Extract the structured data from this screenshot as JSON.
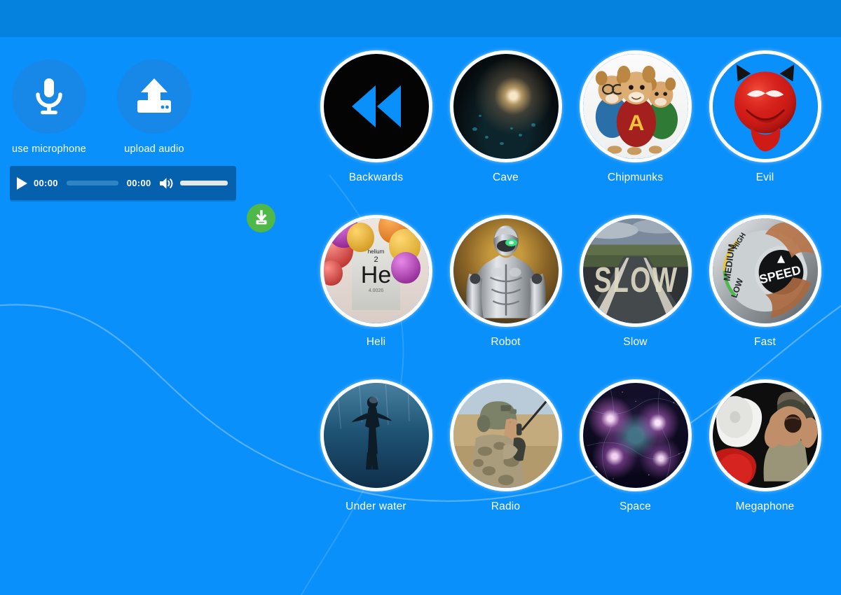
{
  "theme": {
    "background": "#0a90fb",
    "topbar": "#0582de",
    "source_circle": "#1787e8",
    "player_bar": "#0561ad",
    "download_green": "#50b848",
    "label_white": "#ffffff",
    "volume_bar": "#e4e8ea",
    "seek_bar": "#2f84c7"
  },
  "sources": [
    {
      "label": "use microphone",
      "icon": "microphone-icon"
    },
    {
      "label": "upload audio",
      "icon": "upload-icon"
    }
  ],
  "player": {
    "play_icon": "play-icon",
    "current_time": "00:00",
    "total_time": "00:00",
    "volume_icon": "volume-icon",
    "seek_value": 0,
    "volume_value": 100,
    "download_icon": "download-icon"
  },
  "effects": [
    {
      "label": "Backwards",
      "icon": "rewind-icon",
      "style": "bw"
    },
    {
      "label": "Cave",
      "icon": "cave-photo",
      "style": "cave"
    },
    {
      "label": "Chipmunks",
      "icon": "chipmunks-photo",
      "style": "chip"
    },
    {
      "label": "Evil",
      "icon": "devil-face-icon",
      "style": "evil"
    },
    {
      "label": "Heli",
      "icon": "helium-balloons-photo",
      "style": "heli"
    },
    {
      "label": "Robot",
      "icon": "robot-photo",
      "style": "robot"
    },
    {
      "label": "Slow",
      "icon": "slow-road-photo",
      "style": "slow"
    },
    {
      "label": "Fast",
      "icon": "speed-dial-photo",
      "style": "fast"
    },
    {
      "label": "Under water",
      "icon": "underwater-diver-photo",
      "style": "uw"
    },
    {
      "label": "Radio",
      "icon": "soldier-radio-photo",
      "style": "radio"
    },
    {
      "label": "Space",
      "icon": "galaxy-photo",
      "style": "space"
    },
    {
      "label": "Megaphone",
      "icon": "megaphone-photo",
      "style": "mega"
    }
  ],
  "heli_card": {
    "name": "helium",
    "number": "2",
    "symbol": "He",
    "mass": "4.0026"
  },
  "fast_dial": {
    "low": "LOW",
    "medium": "MEDIUM",
    "high": "HIGH",
    "center": "SPEED"
  },
  "slow_road": {
    "text": "SLOW"
  },
  "chipmunks": {
    "letter": "A"
  }
}
